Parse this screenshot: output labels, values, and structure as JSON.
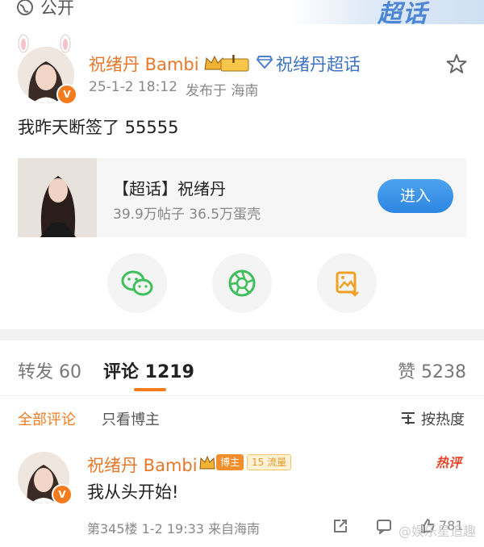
{
  "topbar": {
    "public_label": "公开",
    "watermark": "超话"
  },
  "post": {
    "author_name": "祝绪丹 Bambi",
    "level_badge": "I",
    "topic_link": "祝绪丹超话",
    "timestamp": "25-1-2 18:12",
    "published_from": "发布于 海南",
    "body": "我昨天断签了 55555",
    "star_icon": "star-outline"
  },
  "topic_card": {
    "title": "【超话】祝绪丹",
    "stats": "39.9万帖子 36.5万蛋壳",
    "button": "进入"
  },
  "share_buttons": [
    "wechat-icon",
    "moments-icon",
    "save-image-icon"
  ],
  "stats_tabs": {
    "repost": "转发 60",
    "comment": "评论 1219",
    "like": "赞 5238"
  },
  "comment_filters": {
    "all": "全部评论",
    "owner_only": "只看博主",
    "sort": "按热度"
  },
  "comment": {
    "author_name": "祝绪丹 Bambi",
    "owner_badge": "博主",
    "level_badge": "15 流量",
    "hot_tag": "热评",
    "text": "我从头开始!",
    "floor_meta": "第345楼 1-2 19:33 来自海南",
    "like_count": "781"
  },
  "watermark_bottom": "@娱乐星追趣",
  "colors": {
    "accent_orange": "#f47c1f",
    "name_orange": "#e8772a",
    "button_blue": "#2d86e1"
  }
}
